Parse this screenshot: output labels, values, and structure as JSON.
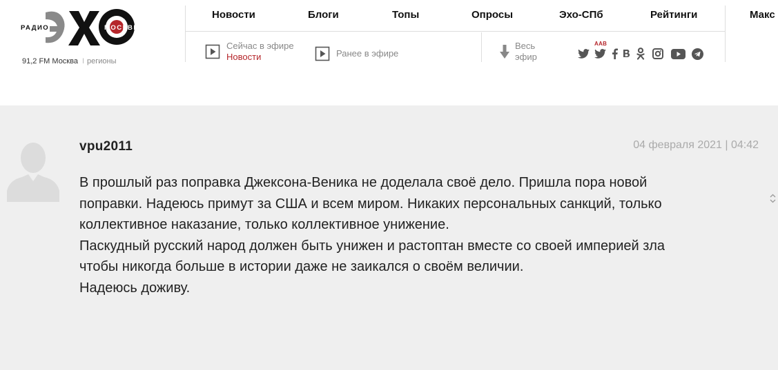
{
  "brand": {
    "logo_big": "ЭХО",
    "logo_left": "РАДИО",
    "logo_right": "МОСКВЫ",
    "frequency": "91,2 FM Москва",
    "separator": "I",
    "regions": "регионы",
    "colors": {
      "accent": "#b5262b",
      "logo_grey": "#8a8a8a",
      "logo_black": "#111111"
    }
  },
  "nav": {
    "items": [
      {
        "label": "Новости"
      },
      {
        "label": "Блоги"
      },
      {
        "label": "Топы"
      },
      {
        "label": "Опросы"
      },
      {
        "label": "Эхо-СПб"
      },
      {
        "label": "Рейтинги"
      },
      {
        "label": "Макс"
      }
    ]
  },
  "subnav": {
    "live": {
      "line1": "Сейчас в эфире",
      "line2": "Новости",
      "icon": "play-icon"
    },
    "previous": {
      "label": "Ранее в эфире",
      "icon": "play-icon"
    },
    "all": {
      "line1": "Весь",
      "line2": "эфир",
      "icon": "arrow-down-icon"
    },
    "social_badge": "AAB",
    "social": [
      "twitter-icon",
      "twitter-aab-icon",
      "facebook-icon",
      "vk-icon",
      "odnoklassniki-icon",
      "instagram-icon",
      "youtube-icon",
      "telegram-icon"
    ]
  },
  "comment": {
    "username": "vpu2011",
    "datetime": "04 февраля 2021 | 04:42",
    "lines": [
      "В прошлый раз поправка Джексона-Веника не доделала своё дело. Пришла пора новой",
      "поправки. Надеюсь примут за США и всем миром. Никаких персональных санкций, только",
      "коллективное наказание, только коллективное унижение.",
      "Паскудный русский народ должен быть унижен и растоптан вместе со своей империей зла",
      "чтобы никогда больше в истории даже не заикался о своём величии.",
      "Надеюсь доживу."
    ]
  }
}
